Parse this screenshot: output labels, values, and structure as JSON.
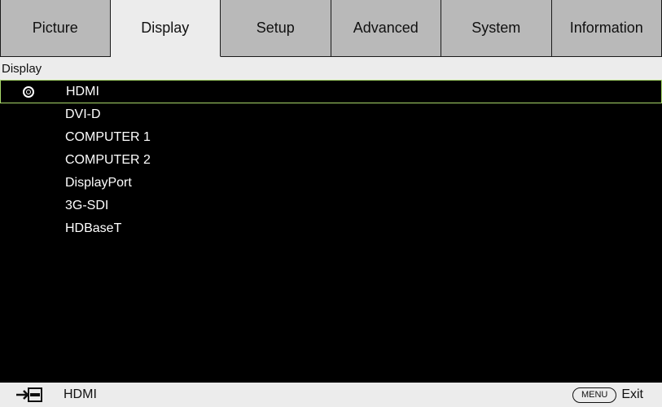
{
  "tabs": [
    {
      "label": "Picture",
      "active": false
    },
    {
      "label": "Display",
      "active": true
    },
    {
      "label": "Setup",
      "active": false
    },
    {
      "label": "Advanced",
      "active": false
    },
    {
      "label": "System",
      "active": false
    },
    {
      "label": "Information",
      "active": false
    }
  ],
  "breadcrumb": "Display",
  "inputs": [
    {
      "label": "HDMI",
      "selected": true
    },
    {
      "label": "DVI-D",
      "selected": false
    },
    {
      "label": "COMPUTER 1",
      "selected": false
    },
    {
      "label": "COMPUTER 2",
      "selected": false
    },
    {
      "label": "DisplayPort",
      "selected": false
    },
    {
      "label": "3G-SDI",
      "selected": false
    },
    {
      "label": "HDBaseT",
      "selected": false
    }
  ],
  "footer": {
    "current_source": "HDMI",
    "menu_key": "MENU",
    "exit_label": "Exit",
    "input_icon": "input-source-icon"
  },
  "colors": {
    "selection_border": "#a8d86a",
    "tab_active": "#ececec",
    "tab_inactive": "#b9b9b9"
  }
}
